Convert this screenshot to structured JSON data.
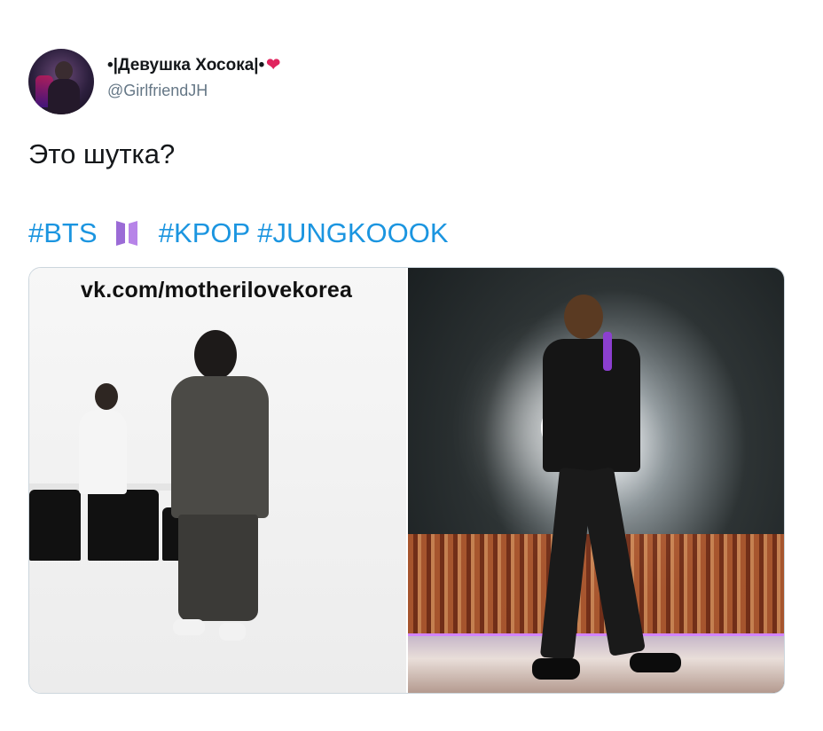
{
  "tweet": {
    "display_name": "•|Девушка Хосока|•",
    "heart": "❤",
    "handle": "@GirlfriendJH",
    "text": "Это шутка?",
    "hashtags": {
      "first": "#BTS",
      "rest": "#KPOP #JUNGKOOOK"
    },
    "media": {
      "watermark": "vk.com/motherilovekorea"
    }
  },
  "colors": {
    "link": "#1b95e0",
    "heart": "#e0245e",
    "muted": "#657786",
    "bts_logo": "#9b6bd6"
  },
  "icons": {
    "heart": "heart-icon",
    "bts": "bts-logo-icon"
  }
}
